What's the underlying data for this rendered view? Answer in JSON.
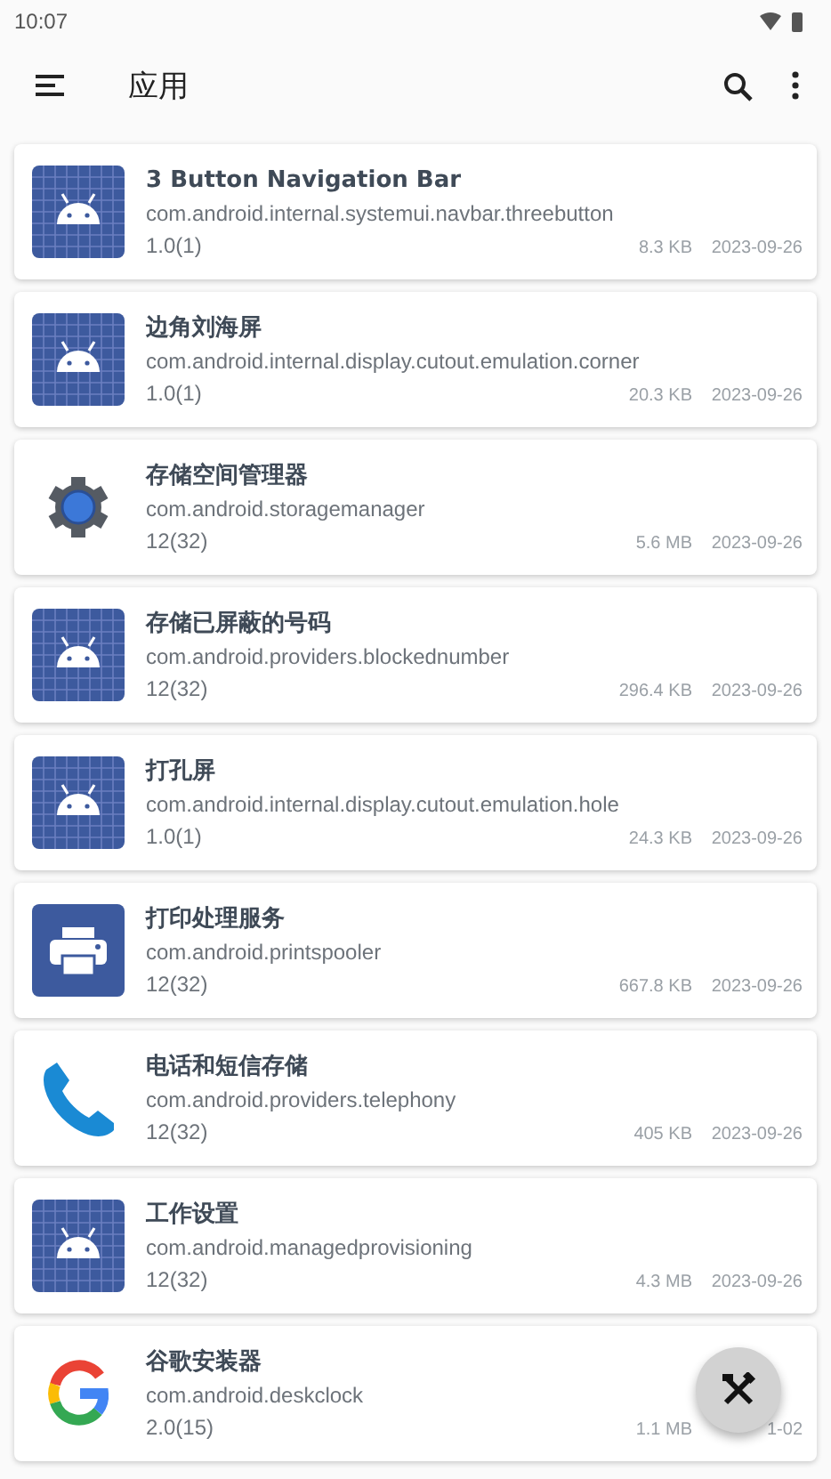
{
  "status_bar": {
    "time": "10:07"
  },
  "toolbar": {
    "title": "应用"
  },
  "apps": [
    {
      "kind": "android",
      "name": "3 Button Navigation Bar",
      "package": "com.android.internal.systemui.navbar.threebutton",
      "version": "1.0(1)",
      "size": "8.3 KB",
      "date": "2023-09-26"
    },
    {
      "kind": "android",
      "name": "边角刘海屏",
      "package": "com.android.internal.display.cutout.emulation.corner",
      "version": "1.0(1)",
      "size": "20.3 KB",
      "date": "2023-09-26"
    },
    {
      "kind": "gear",
      "name": "存储空间管理器",
      "package": "com.android.storagemanager",
      "version": "12(32)",
      "size": "5.6 MB",
      "date": "2023-09-26"
    },
    {
      "kind": "android",
      "name": "存储已屏蔽的号码",
      "package": "com.android.providers.blockednumber",
      "version": "12(32)",
      "size": "296.4 KB",
      "date": "2023-09-26"
    },
    {
      "kind": "android",
      "name": "打孔屏",
      "package": "com.android.internal.display.cutout.emulation.hole",
      "version": "1.0(1)",
      "size": "24.3 KB",
      "date": "2023-09-26"
    },
    {
      "kind": "printer",
      "name": "打印处理服务",
      "package": "com.android.printspooler",
      "version": "12(32)",
      "size": "667.8 KB",
      "date": "2023-09-26"
    },
    {
      "kind": "phone",
      "name": "电话和短信存储",
      "package": "com.android.providers.telephony",
      "version": "12(32)",
      "size": "405 KB",
      "date": "2023-09-26"
    },
    {
      "kind": "android",
      "name": "工作设置",
      "package": "com.android.managedprovisioning",
      "version": "12(32)",
      "size": "4.3 MB",
      "date": "2023-09-26"
    },
    {
      "kind": "google",
      "name": "谷歌安装器",
      "package": "com.android.deskclock",
      "version": "2.0(15)",
      "size": "1.1 MB",
      "date": "1-02"
    }
  ]
}
